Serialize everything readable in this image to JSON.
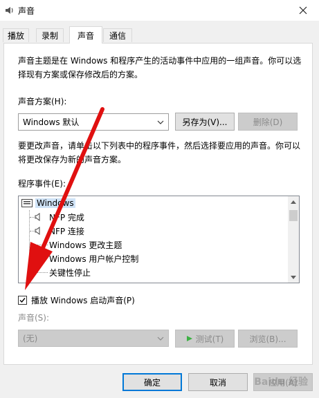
{
  "window": {
    "title": "声音",
    "icon": "speaker-icon"
  },
  "tabs": [
    {
      "label": "播放",
      "active": false
    },
    {
      "label": "录制",
      "active": false
    },
    {
      "label": "声音",
      "active": true
    },
    {
      "label": "通信",
      "active": false
    }
  ],
  "intro_text": "声音主题是在 Windows 和程序产生的活动事件中应用的一组声音。你可以选择现有方案或保存修改后的方案。",
  "scheme": {
    "label": "声音方案(H):",
    "value": "Windows 默认",
    "save_label": "另存为(V)...",
    "delete_label": "删除(D)"
  },
  "instructions_text": "要更改声音，请单击以下列表中的程序事件，然后选择要应用的声音。你可以将更改保存为新的声音方案。",
  "events": {
    "label": "程序事件(E):",
    "root": "Windows",
    "items": [
      {
        "label": "NFP 完成",
        "icon": "speaker-icon"
      },
      {
        "label": "NFP 连接",
        "icon": "speaker-icon"
      },
      {
        "label": "Windows 更改主题",
        "icon": ""
      },
      {
        "label": "Windows 用户帐户控制",
        "icon": "speaker-icon"
      },
      {
        "label": "关键性停止",
        "icon": ""
      }
    ]
  },
  "startup_sound": {
    "label": "播放 Windows 启动声音(P)",
    "checked": true
  },
  "sound": {
    "label": "声音(S):",
    "value": "(无)",
    "test_label": "测试(T)",
    "browse_label": "浏览(B)..."
  },
  "footer": {
    "ok_label": "确定",
    "cancel_label": "取消",
    "apply_label": "应用(A)"
  },
  "watermark": "Baidu 经验",
  "colors": {
    "accent": "#0078d7",
    "annotation_arrow": "#e01010"
  }
}
